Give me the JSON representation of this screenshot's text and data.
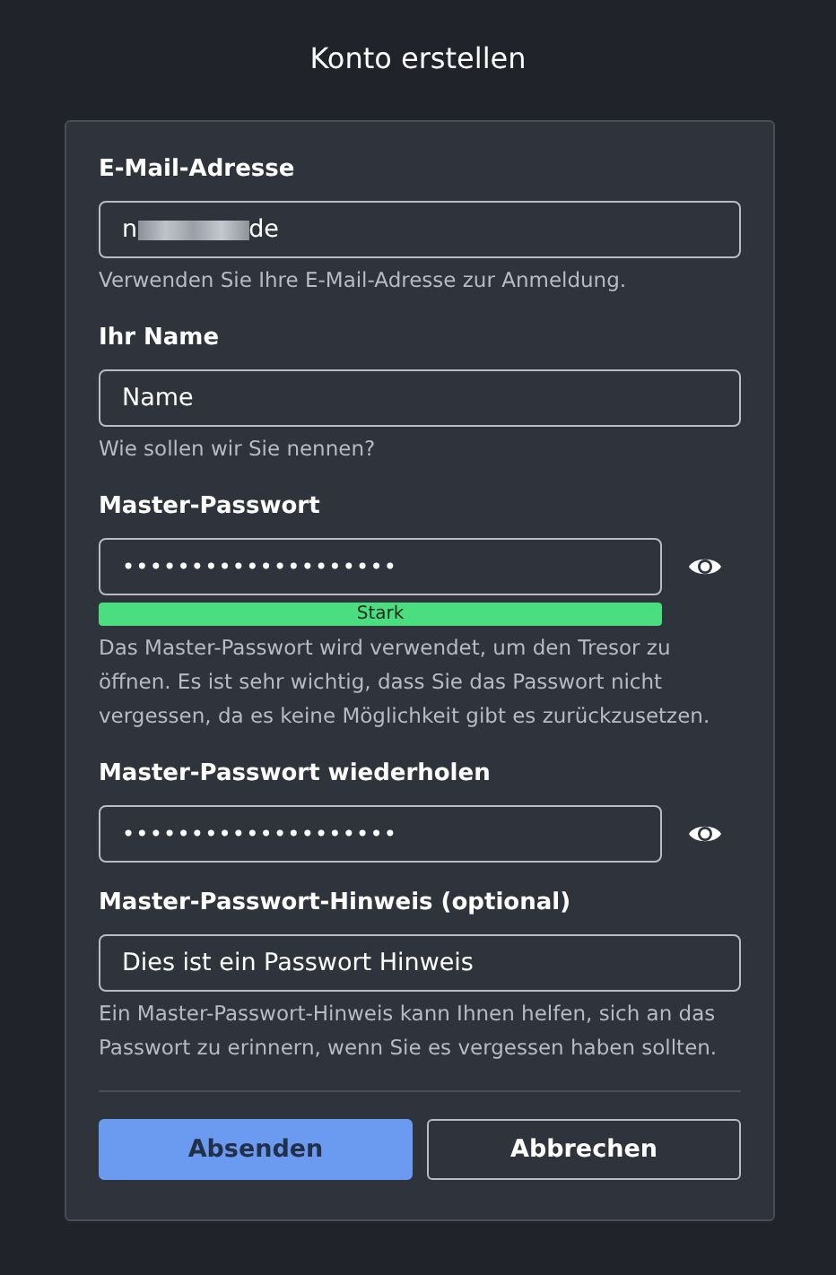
{
  "title": "Konto erstellen",
  "fields": [
    {
      "kind": "email",
      "label": "E-Mail-Adresse",
      "value_start": "n",
      "value_end": "de",
      "redacted": true,
      "hint": "Verwenden Sie Ihre E-Mail-Adresse zur Anmeldung."
    },
    {
      "kind": "text",
      "label": "Ihr Name",
      "value": "Name",
      "hint": "Wie sollen wir Sie nennen?"
    },
    {
      "kind": "password",
      "label": "Master-Passwort",
      "value": "••••••••••••••••••••",
      "strength": {
        "label": "Stark",
        "level": 1,
        "color": "#4ade80"
      },
      "hint": "Das Master-Passwort wird verwendet, um den Tresor zu öffnen. Es ist sehr wichtig, dass Sie das Passwort nicht vergessen, da es keine Möglichkeit gibt es zurückzusetzen."
    },
    {
      "kind": "password",
      "label": "Master-Passwort wiederholen",
      "value": "••••••••••••••••••••"
    },
    {
      "kind": "text",
      "label": "Master-Passwort-Hinweis (optional)",
      "value": "Dies ist ein Passwort Hinweis",
      "hint": "Ein Master-Passwort-Hinweis kann Ihnen helfen, sich an das Passwort zu erinnern, wenn Sie es vergessen haben sollten."
    }
  ],
  "buttons": [
    {
      "label": "Absenden",
      "kind": "primary"
    },
    {
      "label": "Abbrechen",
      "kind": "secondary"
    }
  ]
}
